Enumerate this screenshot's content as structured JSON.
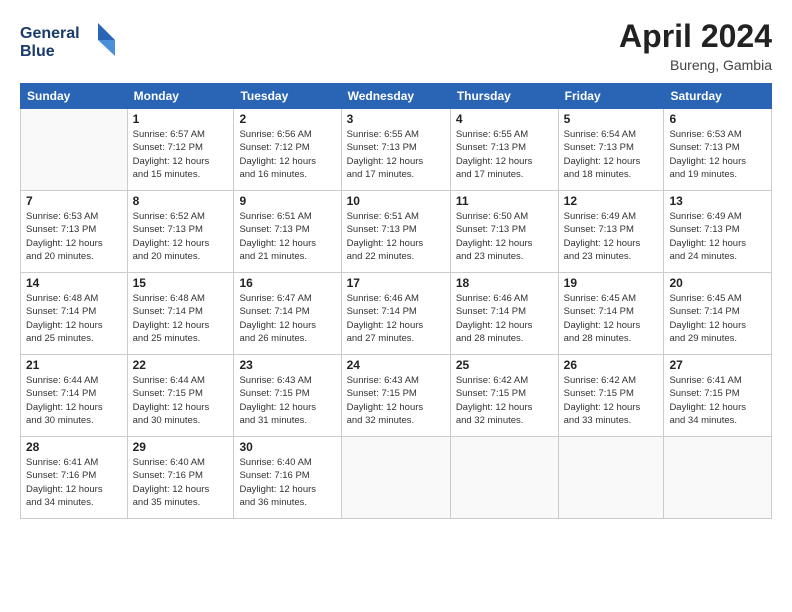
{
  "logo": {
    "line1": "General",
    "line2": "Blue"
  },
  "title": "April 2024",
  "location": "Bureng, Gambia",
  "days_header": [
    "Sunday",
    "Monday",
    "Tuesday",
    "Wednesday",
    "Thursday",
    "Friday",
    "Saturday"
  ],
  "weeks": [
    [
      {
        "day": "",
        "info": ""
      },
      {
        "day": "1",
        "info": "Sunrise: 6:57 AM\nSunset: 7:12 PM\nDaylight: 12 hours\nand 15 minutes."
      },
      {
        "day": "2",
        "info": "Sunrise: 6:56 AM\nSunset: 7:12 PM\nDaylight: 12 hours\nand 16 minutes."
      },
      {
        "day": "3",
        "info": "Sunrise: 6:55 AM\nSunset: 7:13 PM\nDaylight: 12 hours\nand 17 minutes."
      },
      {
        "day": "4",
        "info": "Sunrise: 6:55 AM\nSunset: 7:13 PM\nDaylight: 12 hours\nand 17 minutes."
      },
      {
        "day": "5",
        "info": "Sunrise: 6:54 AM\nSunset: 7:13 PM\nDaylight: 12 hours\nand 18 minutes."
      },
      {
        "day": "6",
        "info": "Sunrise: 6:53 AM\nSunset: 7:13 PM\nDaylight: 12 hours\nand 19 minutes."
      }
    ],
    [
      {
        "day": "7",
        "info": "Sunrise: 6:53 AM\nSunset: 7:13 PM\nDaylight: 12 hours\nand 20 minutes."
      },
      {
        "day": "8",
        "info": "Sunrise: 6:52 AM\nSunset: 7:13 PM\nDaylight: 12 hours\nand 20 minutes."
      },
      {
        "day": "9",
        "info": "Sunrise: 6:51 AM\nSunset: 7:13 PM\nDaylight: 12 hours\nand 21 minutes."
      },
      {
        "day": "10",
        "info": "Sunrise: 6:51 AM\nSunset: 7:13 PM\nDaylight: 12 hours\nand 22 minutes."
      },
      {
        "day": "11",
        "info": "Sunrise: 6:50 AM\nSunset: 7:13 PM\nDaylight: 12 hours\nand 23 minutes."
      },
      {
        "day": "12",
        "info": "Sunrise: 6:49 AM\nSunset: 7:13 PM\nDaylight: 12 hours\nand 23 minutes."
      },
      {
        "day": "13",
        "info": "Sunrise: 6:49 AM\nSunset: 7:13 PM\nDaylight: 12 hours\nand 24 minutes."
      }
    ],
    [
      {
        "day": "14",
        "info": "Sunrise: 6:48 AM\nSunset: 7:14 PM\nDaylight: 12 hours\nand 25 minutes."
      },
      {
        "day": "15",
        "info": "Sunrise: 6:48 AM\nSunset: 7:14 PM\nDaylight: 12 hours\nand 25 minutes."
      },
      {
        "day": "16",
        "info": "Sunrise: 6:47 AM\nSunset: 7:14 PM\nDaylight: 12 hours\nand 26 minutes."
      },
      {
        "day": "17",
        "info": "Sunrise: 6:46 AM\nSunset: 7:14 PM\nDaylight: 12 hours\nand 27 minutes."
      },
      {
        "day": "18",
        "info": "Sunrise: 6:46 AM\nSunset: 7:14 PM\nDaylight: 12 hours\nand 28 minutes."
      },
      {
        "day": "19",
        "info": "Sunrise: 6:45 AM\nSunset: 7:14 PM\nDaylight: 12 hours\nand 28 minutes."
      },
      {
        "day": "20",
        "info": "Sunrise: 6:45 AM\nSunset: 7:14 PM\nDaylight: 12 hours\nand 29 minutes."
      }
    ],
    [
      {
        "day": "21",
        "info": "Sunrise: 6:44 AM\nSunset: 7:14 PM\nDaylight: 12 hours\nand 30 minutes."
      },
      {
        "day": "22",
        "info": "Sunrise: 6:44 AM\nSunset: 7:15 PM\nDaylight: 12 hours\nand 30 minutes."
      },
      {
        "day": "23",
        "info": "Sunrise: 6:43 AM\nSunset: 7:15 PM\nDaylight: 12 hours\nand 31 minutes."
      },
      {
        "day": "24",
        "info": "Sunrise: 6:43 AM\nSunset: 7:15 PM\nDaylight: 12 hours\nand 32 minutes."
      },
      {
        "day": "25",
        "info": "Sunrise: 6:42 AM\nSunset: 7:15 PM\nDaylight: 12 hours\nand 32 minutes."
      },
      {
        "day": "26",
        "info": "Sunrise: 6:42 AM\nSunset: 7:15 PM\nDaylight: 12 hours\nand 33 minutes."
      },
      {
        "day": "27",
        "info": "Sunrise: 6:41 AM\nSunset: 7:15 PM\nDaylight: 12 hours\nand 34 minutes."
      }
    ],
    [
      {
        "day": "28",
        "info": "Sunrise: 6:41 AM\nSunset: 7:16 PM\nDaylight: 12 hours\nand 34 minutes."
      },
      {
        "day": "29",
        "info": "Sunrise: 6:40 AM\nSunset: 7:16 PM\nDaylight: 12 hours\nand 35 minutes."
      },
      {
        "day": "30",
        "info": "Sunrise: 6:40 AM\nSunset: 7:16 PM\nDaylight: 12 hours\nand 36 minutes."
      },
      {
        "day": "",
        "info": ""
      },
      {
        "day": "",
        "info": ""
      },
      {
        "day": "",
        "info": ""
      },
      {
        "day": "",
        "info": ""
      }
    ]
  ]
}
